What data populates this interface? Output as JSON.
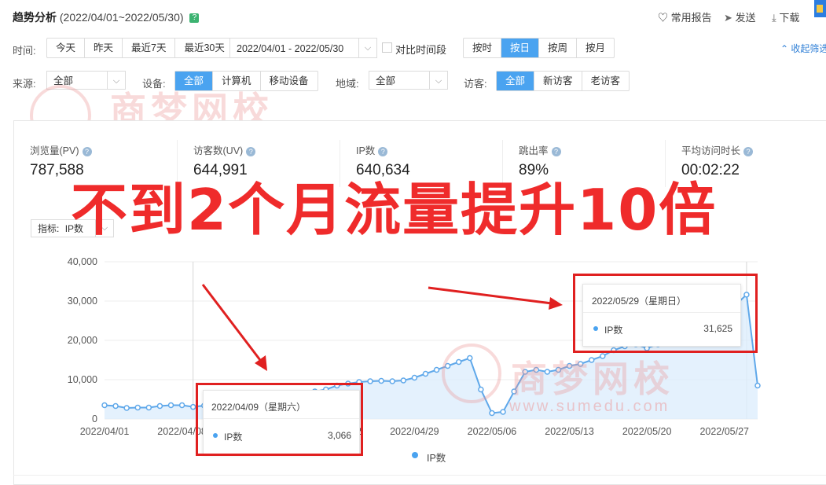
{
  "header": {
    "title": "趋势分析",
    "date_range": "(2022/04/01~2022/05/30)",
    "help": "?",
    "links": [
      "常用报告",
      "发送",
      "下载"
    ]
  },
  "filters": {
    "time_label": "时间:",
    "time_presets": [
      "今天",
      "昨天",
      "最近7天",
      "最近30天"
    ],
    "date_input": "2022/04/01 - 2022/05/30",
    "compare_label": "对比时间段",
    "granularity": [
      "按时",
      "按日",
      "按周",
      "按月"
    ],
    "granularity_active": "按日",
    "collapse_label": "收起筛选",
    "source_label": "来源:",
    "source_value": "全部",
    "device_label": "设备:",
    "device_options": [
      "全部",
      "计算机",
      "移动设备"
    ],
    "region_label": "地域:",
    "region_value": "全部",
    "visitor_label": "访客:",
    "visitor_options": [
      "全部",
      "新访客",
      "老访客"
    ]
  },
  "metrics": [
    {
      "label": "浏览量(PV)",
      "value": "787,588"
    },
    {
      "label": "访客数(UV)",
      "value": "644,991"
    },
    {
      "label": "IP数",
      "value": "640,634"
    },
    {
      "label": "跳出率",
      "value": "89%"
    },
    {
      "label": "平均访问时长",
      "value": "00:02:22"
    }
  ],
  "overlay_text": "不到2个月流量提升10倍",
  "indicator": {
    "label": "指标:",
    "value": "IP数"
  },
  "watermark": {
    "brand": "商梦网校",
    "url": "www.sumedu.com"
  },
  "tooltip_left": {
    "date": "2022/04/09（星期六）",
    "series": "IP数",
    "value": "3,066"
  },
  "tooltip_right": {
    "date": "2022/05/29（星期日）",
    "series": "IP数",
    "value": "31,625"
  },
  "colors": {
    "accent": "#4aa3f0",
    "line": "#5fa8ea",
    "area": "#ddeefc",
    "annotation": "#e02020"
  },
  "chart_data": {
    "type": "area",
    "legend": [
      "IP数"
    ],
    "x_ticks": [
      "2022/04/01",
      "2022/04/08",
      "2022/04/15",
      "2022/04/22",
      "2022/04/29",
      "2022/05/06",
      "2022/05/13",
      "2022/05/20",
      "2022/05/27"
    ],
    "y_ticks": [
      "0",
      "10,000",
      "20,000",
      "30,000",
      "40,000"
    ],
    "ylim": [
      0,
      40000
    ],
    "series": [
      {
        "name": "IP数",
        "x": [
          "2022/04/01",
          "2022/04/02",
          "2022/04/03",
          "2022/04/04",
          "2022/04/05",
          "2022/04/06",
          "2022/04/07",
          "2022/04/08",
          "2022/04/09",
          "2022/04/10",
          "2022/04/11",
          "2022/04/12",
          "2022/04/13",
          "2022/04/14",
          "2022/04/15",
          "2022/04/16",
          "2022/04/17",
          "2022/04/18",
          "2022/04/19",
          "2022/04/20",
          "2022/04/21",
          "2022/04/22",
          "2022/04/23",
          "2022/04/24",
          "2022/04/25",
          "2022/04/26",
          "2022/04/27",
          "2022/04/28",
          "2022/04/29",
          "2022/04/30",
          "2022/05/01",
          "2022/05/02",
          "2022/05/03",
          "2022/05/04",
          "2022/05/05",
          "2022/05/06",
          "2022/05/07",
          "2022/05/08",
          "2022/05/09",
          "2022/05/10",
          "2022/05/11",
          "2022/05/12",
          "2022/05/13",
          "2022/05/14",
          "2022/05/15",
          "2022/05/16",
          "2022/05/17",
          "2022/05/18",
          "2022/05/19",
          "2022/05/20",
          "2022/05/21",
          "2022/05/22",
          "2022/05/23",
          "2022/05/24",
          "2022/05/25",
          "2022/05/26",
          "2022/05/27",
          "2022/05/28",
          "2022/05/29",
          "2022/05/30"
        ],
        "values": [
          3500,
          3300,
          2800,
          2900,
          2900,
          3300,
          3500,
          3500,
          3066,
          3400,
          3800,
          4200,
          4500,
          4800,
          5000,
          5300,
          5500,
          6000,
          6500,
          7000,
          7500,
          8500,
          9000,
          9400,
          9600,
          9700,
          9600,
          9800,
          10500,
          11500,
          12500,
          13500,
          14500,
          15500,
          7500,
          1500,
          1800,
          7000,
          12000,
          12500,
          12000,
          12500,
          13500,
          14000,
          15000,
          16000,
          17500,
          18500,
          19000,
          18000,
          19000,
          20500,
          22000,
          24000,
          27000,
          29000,
          29500,
          29000,
          31625,
          8500
        ]
      }
    ]
  }
}
